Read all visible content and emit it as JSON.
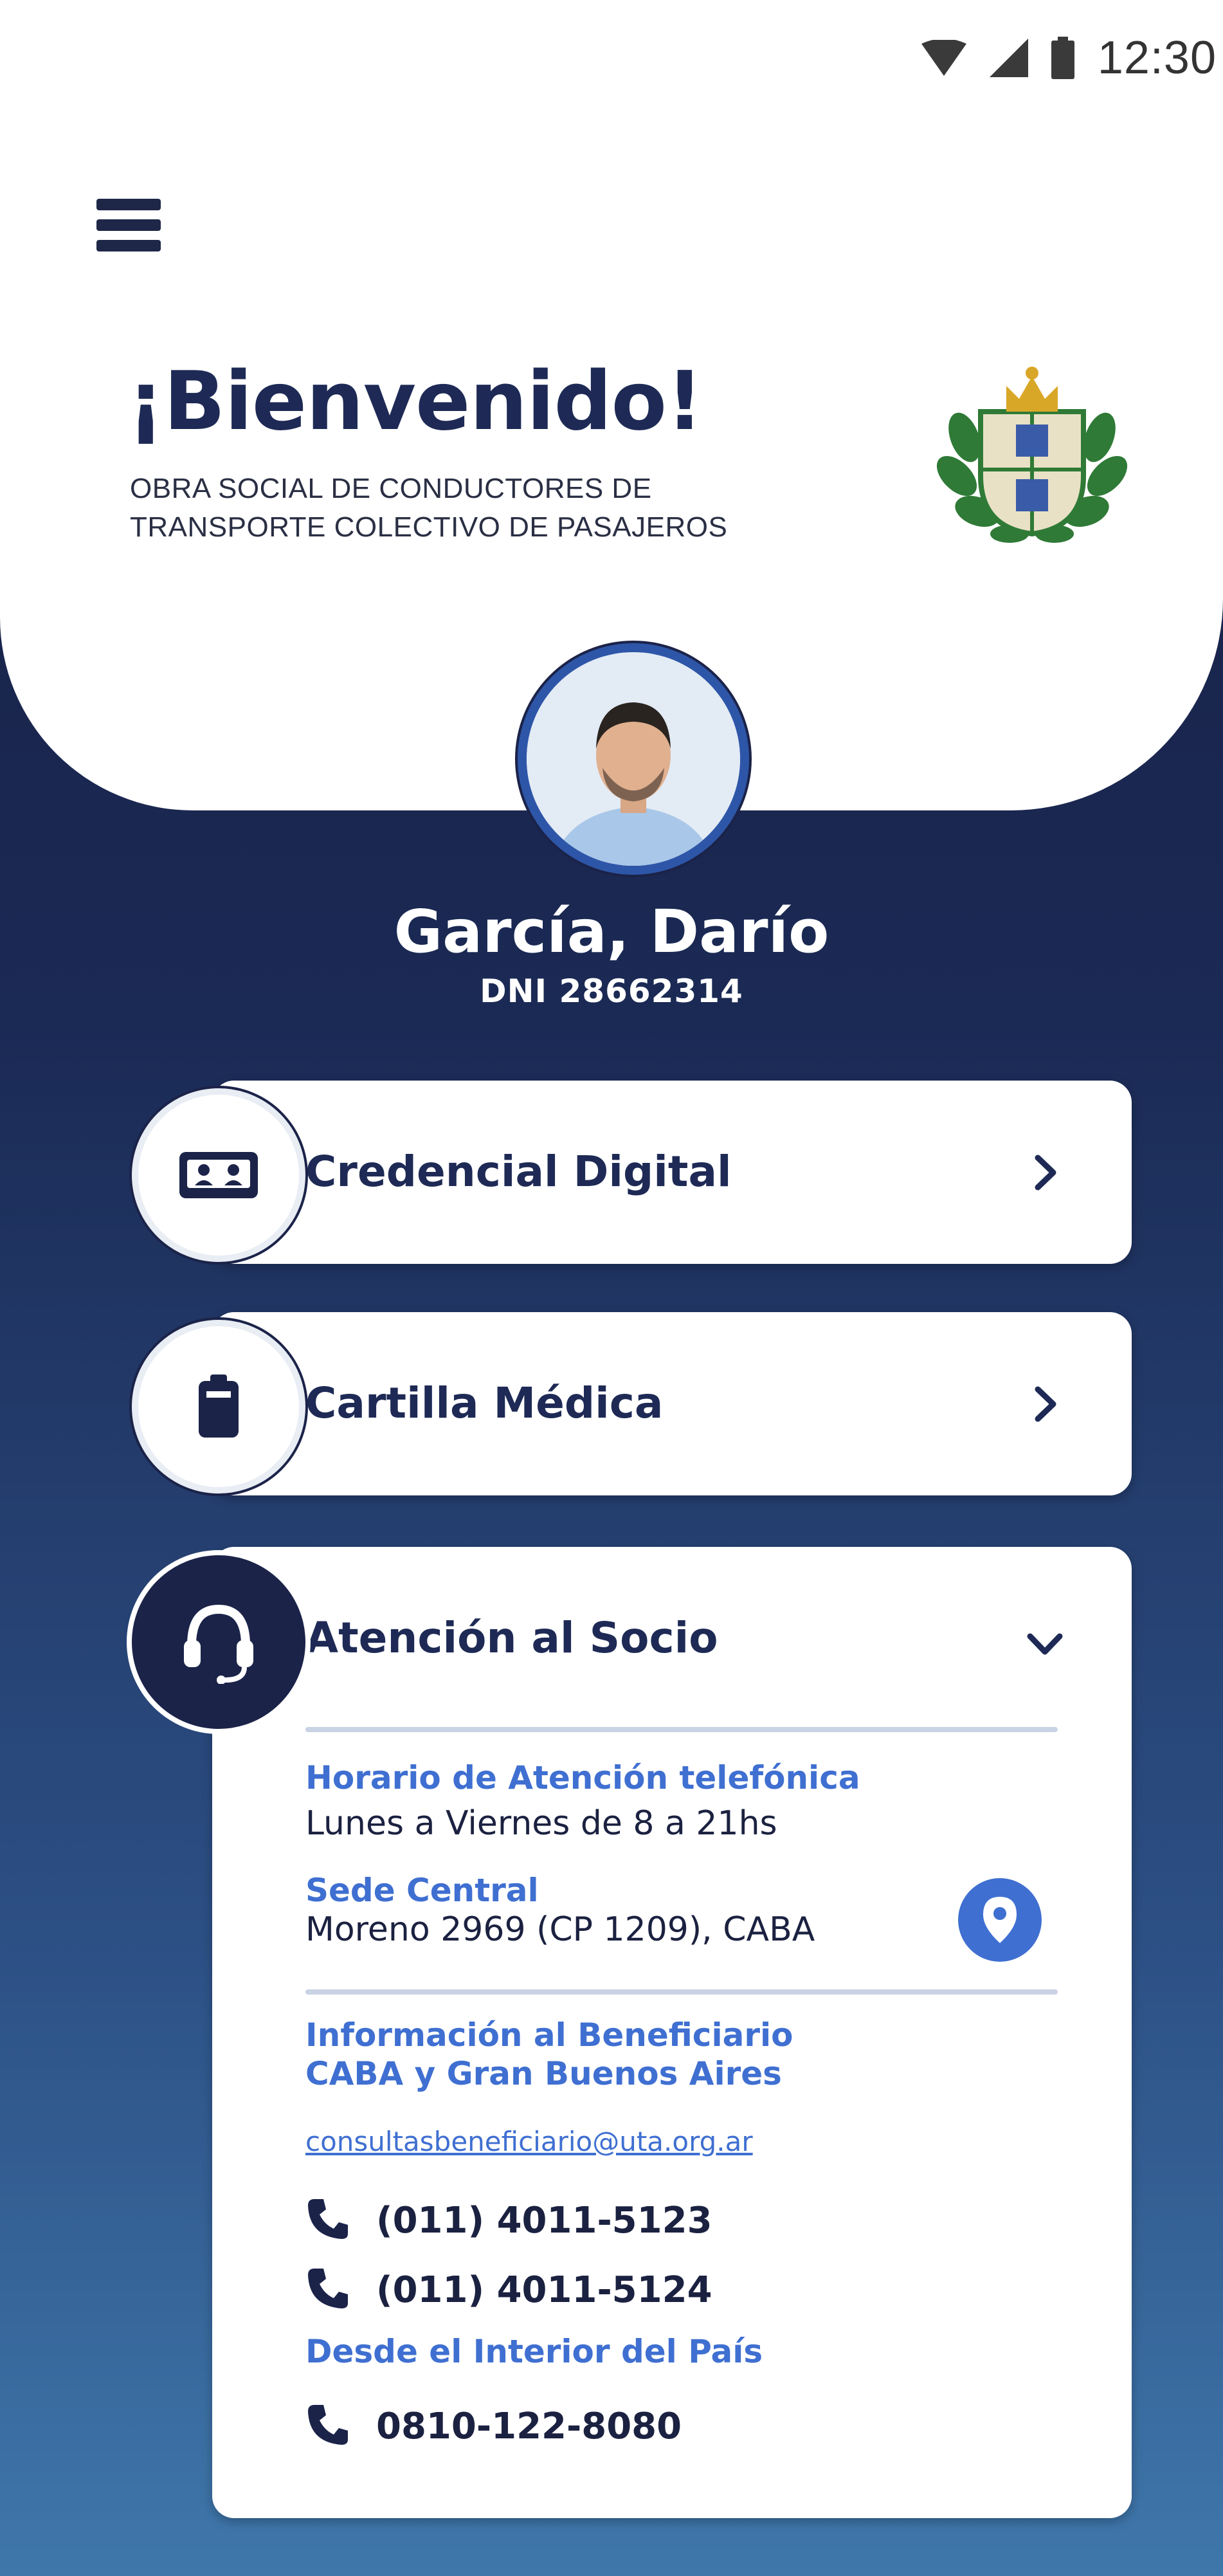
{
  "status_bar": {
    "time": "12:30",
    "icons": [
      "wifi-icon",
      "signal-icon",
      "battery-icon"
    ]
  },
  "header": {
    "menu_icon": "hamburger-menu-icon",
    "title": "¡Bienvenido!",
    "subtitle_line1": "OBRA SOCIAL DE CONDUCTORES DE",
    "subtitle_line2": "TRANSPORTE COLECTIVO DE PASAJEROS",
    "logo": "organization-crest-logo"
  },
  "user": {
    "name": "García, Darío",
    "dni": "DNI 28662314"
  },
  "cards": {
    "credencial": {
      "label": "Credencial Digital",
      "icon": "id-card-icon"
    },
    "cartilla": {
      "label": "Cartilla Médica",
      "icon": "medical-directory-icon"
    },
    "atencion": {
      "label": "Atención al Socio",
      "icon": "headset-icon",
      "horario_label": "Horario de Atención telefónica",
      "horario_value": "Lunes a Viernes de 8 a 21hs",
      "sede_label": "Sede Central",
      "sede_value": "Moreno 2969 (CP 1209), CABA",
      "info_label_line1": "Información al Beneficiario",
      "info_label_line2": "CABA y Gran Buenos Aires",
      "email": "consultasbeneficiario@uta.org.ar",
      "phone1": "(011) 4011-5123",
      "phone2": "(011) 4011-5124",
      "interior_label": "Desde el Interior del País",
      "phone3": "0810-122-8080"
    }
  },
  "colors": {
    "navy": "#1b2349",
    "accent_blue": "#3f6fd1",
    "title": "#1e2a55"
  }
}
